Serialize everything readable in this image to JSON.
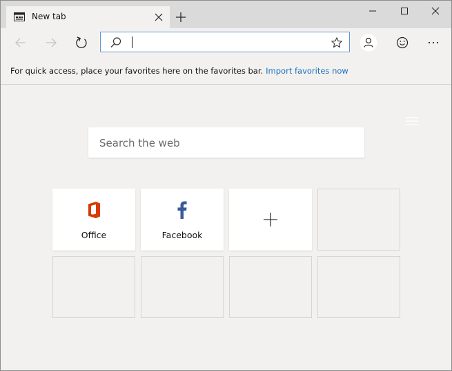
{
  "tab": {
    "title": "New tab"
  },
  "address": {
    "value": ""
  },
  "favorites_bar": {
    "message": "For quick access, place your favorites here on the favorites bar.",
    "link": "Import favorites now"
  },
  "search": {
    "placeholder": "Search the web"
  },
  "tiles": [
    {
      "label": "Office",
      "icon": "office-icon",
      "color": "#d83b01"
    },
    {
      "label": "Facebook",
      "icon": "facebook-icon",
      "color": "#3b5998"
    },
    {
      "label": "",
      "icon": "add-icon"
    }
  ],
  "colors": {
    "link": "#1a6fbf",
    "address_focus_border": "#5f95d4",
    "titlebar": "#dadada",
    "background": "#f2f1ef"
  }
}
